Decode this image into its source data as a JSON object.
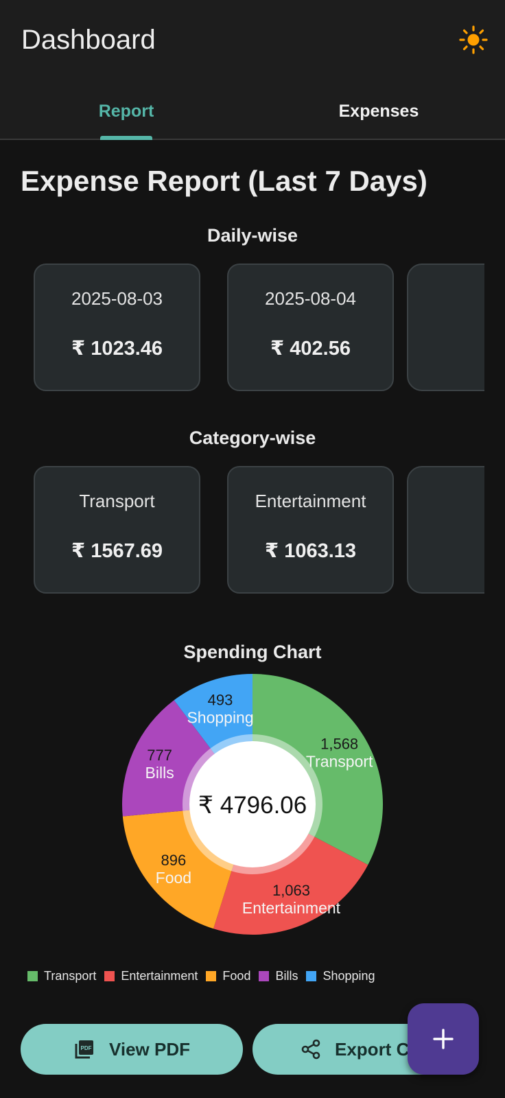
{
  "app_bar": {
    "title": "Dashboard",
    "theme_icon": "sun-icon"
  },
  "tabs": [
    {
      "label": "Report",
      "selected": true
    },
    {
      "label": "Expenses",
      "selected": false
    }
  ],
  "report": {
    "heading": "Expense Report (Last 7 Days)",
    "daily_title": "Daily-wise",
    "daily": [
      {
        "date": "2025-08-03",
        "amount": "₹ 1023.46"
      },
      {
        "date": "2025-08-04",
        "amount": "₹ 402.56"
      }
    ],
    "category_title": "Category-wise",
    "categories": [
      {
        "name": "Transport",
        "amount": "₹ 1567.69"
      },
      {
        "name": "Entertainment",
        "amount": "₹ 1063.13"
      }
    ],
    "chart_title": "Spending Chart"
  },
  "chart_data": {
    "type": "pie",
    "title": "Spending Chart",
    "center_label": "₹ 4796.06",
    "slices": [
      {
        "label": "Transport",
        "value": 1568,
        "value_label": "1,568",
        "color": "#66bb6a"
      },
      {
        "label": "Entertainment",
        "value": 1063,
        "value_label": "1,063",
        "color": "#ef5350"
      },
      {
        "label": "Food",
        "value": 896,
        "value_label": "896",
        "color": "#ffa726"
      },
      {
        "label": "Bills",
        "value": 777,
        "value_label": "777",
        "color": "#ab47bc"
      },
      {
        "label": "Shopping",
        "value": 493,
        "value_label": "493",
        "color": "#42a5f5"
      }
    ],
    "legend_position": "bottom"
  },
  "actions": {
    "view_pdf": "View PDF",
    "export_csv": "Export CS",
    "fab_icon": "plus-icon"
  },
  "colors": {
    "accent": "#55b6a8",
    "button_bg": "#83cdc4",
    "fab_bg": "#4f3a92",
    "sun": "#ffa000"
  }
}
